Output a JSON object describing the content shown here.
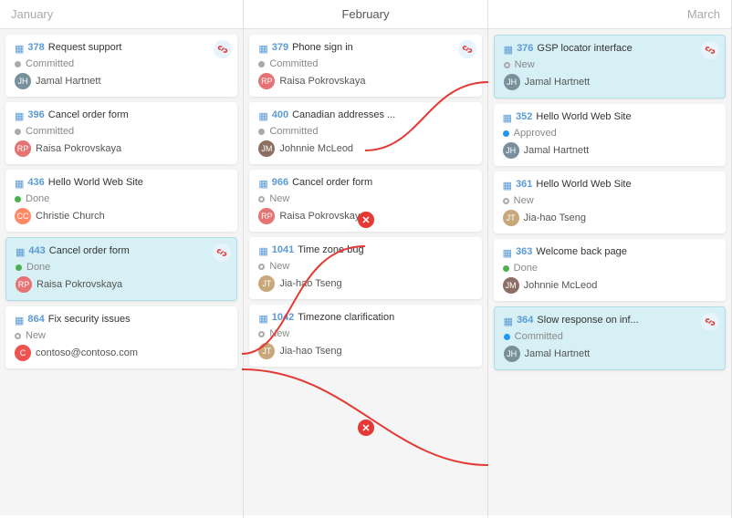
{
  "columns": [
    {
      "id": "january",
      "label": "January",
      "cards": [
        {
          "id": "378",
          "title": "Request support",
          "status": "Committed",
          "statusType": "committed",
          "assignee": "Jamal Hartnett",
          "assigneeType": "jamal",
          "hasLink": true,
          "highlighted": false
        },
        {
          "id": "396",
          "title": "Cancel order form",
          "status": "Committed",
          "statusType": "committed",
          "assignee": "Raisa Pokrovskaya",
          "assigneeType": "raisa",
          "hasLink": false,
          "highlighted": false
        },
        {
          "id": "436",
          "title": "Hello World Web Site",
          "status": "Done",
          "statusType": "done",
          "assignee": "Christie Church",
          "assigneeType": "christie",
          "hasLink": false,
          "highlighted": false
        },
        {
          "id": "443",
          "title": "Cancel order form",
          "status": "Done",
          "statusType": "done",
          "assignee": "Raisa Pokrovskaya",
          "assigneeType": "raisa",
          "hasLink": true,
          "highlighted": true
        },
        {
          "id": "864",
          "title": "Fix security issues",
          "status": "New",
          "statusType": "new",
          "assignee": "contoso@contoso.com",
          "assigneeType": "contoso",
          "hasLink": false,
          "highlighted": false
        }
      ]
    },
    {
      "id": "february",
      "label": "February",
      "cards": [
        {
          "id": "379",
          "title": "Phone sign in",
          "status": "Committed",
          "statusType": "committed",
          "assignee": "Raisa Pokrovskaya",
          "assigneeType": "raisa",
          "hasLink": true,
          "highlighted": false
        },
        {
          "id": "400",
          "title": "Canadian addresses ...",
          "status": "Committed",
          "statusType": "committed",
          "assignee": "Johnnie McLeod",
          "assigneeType": "johnnie",
          "hasLink": false,
          "highlighted": false
        },
        {
          "id": "966",
          "title": "Cancel order form",
          "status": "New",
          "statusType": "new",
          "assignee": "Raisa Pokrovskaya",
          "assigneeType": "raisa",
          "hasLink": false,
          "highlighted": false
        },
        {
          "id": "1041",
          "title": "Time zone bug",
          "status": "New",
          "statusType": "new",
          "assignee": "Jia-hao Tseng",
          "assigneeType": "jiahao",
          "hasLink": false,
          "highlighted": false
        },
        {
          "id": "1042",
          "title": "Timezone clarification",
          "status": "New",
          "statusType": "new",
          "assignee": "Jia-hao Tseng",
          "assigneeType": "jiahao",
          "hasLink": false,
          "highlighted": false
        }
      ]
    },
    {
      "id": "march",
      "label": "March",
      "cards": [
        {
          "id": "376",
          "title": "GSP locator interface",
          "status": "New",
          "statusType": "new",
          "assignee": "Jamal Hartnett",
          "assigneeType": "jamal",
          "hasLink": true,
          "highlighted": true
        },
        {
          "id": "352",
          "title": "Hello World Web Site",
          "status": "Approved",
          "statusType": "approved",
          "assignee": "Jamal Hartnett",
          "assigneeType": "jamal",
          "hasLink": false,
          "highlighted": false
        },
        {
          "id": "361",
          "title": "Hello World Web Site",
          "status": "New",
          "statusType": "new",
          "assignee": "Jia-hao Tseng",
          "assigneeType": "jiahao",
          "hasLink": false,
          "highlighted": false
        },
        {
          "id": "363",
          "title": "Welcome back page",
          "status": "Done",
          "statusType": "done",
          "assignee": "Johnnie McLeod",
          "assigneeType": "johnnie",
          "hasLink": false,
          "highlighted": false
        },
        {
          "id": "364",
          "title": "Slow response on inf...",
          "status": "Committed",
          "statusType": "committed-blue",
          "assignee": "Jamal Hartnett",
          "assigneeType": "jamal",
          "hasLink": true,
          "highlighted": true
        }
      ]
    }
  ],
  "icons": {
    "grid": "▦",
    "link": "🔗",
    "close": "✕"
  }
}
